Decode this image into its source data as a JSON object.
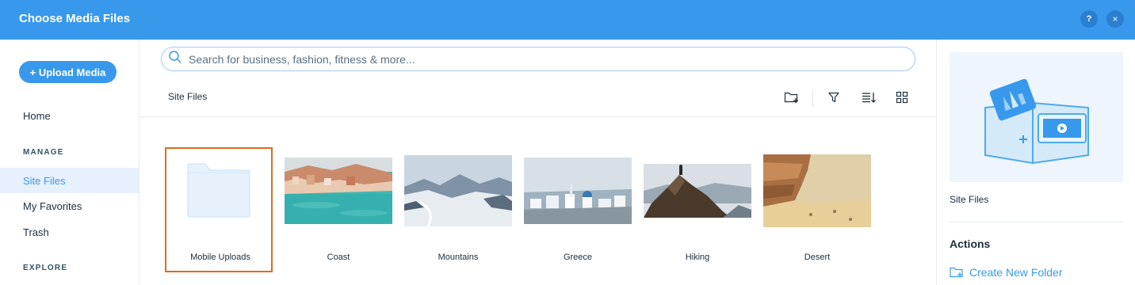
{
  "window": {
    "title": "Choose Media Files",
    "help_label": "?",
    "close_label": "×"
  },
  "sidebar": {
    "upload_label": "+ Upload Media",
    "home_label": "Home",
    "manage_heading": "MANAGE",
    "items": [
      {
        "label": "Site Files",
        "active": true
      },
      {
        "label": "My Favorites",
        "active": false
      },
      {
        "label": "Trash",
        "active": false
      }
    ],
    "explore_heading": "EXPLORE"
  },
  "search": {
    "placeholder": "Search for business, fashion, fitness & more...",
    "value": ""
  },
  "breadcrumb": "Site Files",
  "toolbar": {
    "icons": [
      "add-folder-icon",
      "filter-icon",
      "sort-icon",
      "grid-view-icon"
    ]
  },
  "files": [
    {
      "label": "Mobile Uploads",
      "kind": "folder",
      "selected": true
    },
    {
      "label": "Coast",
      "kind": "image"
    },
    {
      "label": "Mountains",
      "kind": "image"
    },
    {
      "label": "Greece",
      "kind": "image"
    },
    {
      "label": "Hiking",
      "kind": "image"
    },
    {
      "label": "Desert",
      "kind": "image"
    }
  ],
  "right_panel": {
    "folder_name": "Site Files",
    "actions_heading": "Actions",
    "create_folder_label": "Create New Folder"
  },
  "colors": {
    "accent": "#3899ec",
    "selection": "#e06a1d",
    "active_bg": "#e7f0ff"
  }
}
